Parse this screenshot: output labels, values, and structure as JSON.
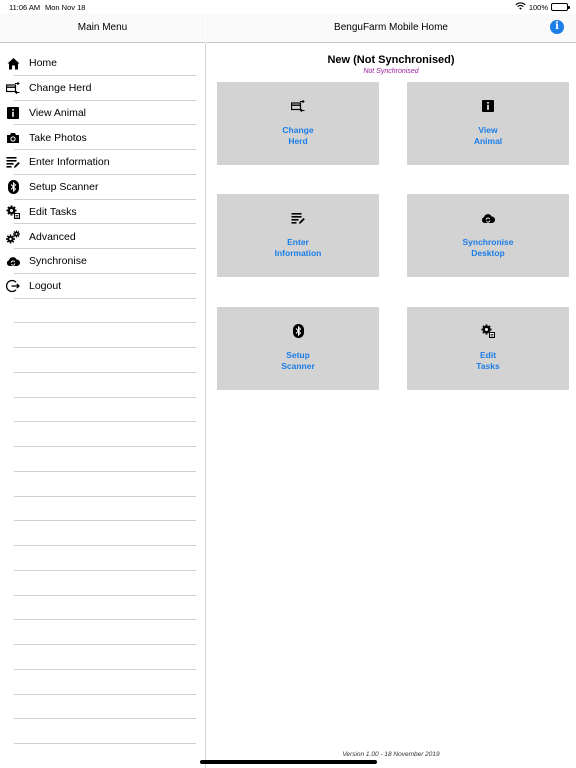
{
  "status_bar": {
    "time": "11:06 AM",
    "date": "Mon Nov 18",
    "battery": "100%",
    "icons": [
      "wifi-icon",
      "battery-icon"
    ]
  },
  "left_nav": {
    "title": "Main Menu"
  },
  "right_nav": {
    "title": "BenguFarm Mobile Home",
    "info_icon": "info-icon"
  },
  "sidebar": {
    "items": [
      {
        "label": "Home",
        "icon": "home-icon"
      },
      {
        "label": "Change Herd",
        "icon": "change-herd-icon"
      },
      {
        "label": "View Animal",
        "icon": "info-square-icon"
      },
      {
        "label": "Take Photos",
        "icon": "camera-icon"
      },
      {
        "label": "Enter Information",
        "icon": "edit-notes-icon"
      },
      {
        "label": "Setup Scanner",
        "icon": "bluetooth-icon"
      },
      {
        "label": "Edit Tasks",
        "icon": "gear-doc-icon"
      },
      {
        "label": "Advanced",
        "icon": "gears-icon"
      },
      {
        "label": "Synchronise",
        "icon": "cloud-sync-icon"
      },
      {
        "label": "Logout",
        "icon": "logout-icon"
      }
    ]
  },
  "main": {
    "title": "New (Not Synchronised)",
    "subtitle": "Not Synchronised",
    "tiles": [
      {
        "line1": "Change",
        "line2": "Herd",
        "icon": "change-herd-icon"
      },
      {
        "line1": "View",
        "line2": "Animal",
        "icon": "info-square-icon"
      },
      {
        "line1": "Enter",
        "line2": "Information",
        "icon": "edit-notes-icon"
      },
      {
        "line1": "Synchronise",
        "line2": "Desktop",
        "icon": "cloud-sync-icon"
      },
      {
        "line1": "Setup",
        "line2": "Scanner",
        "icon": "bluetooth-icon"
      },
      {
        "line1": "Edit",
        "line2": "Tasks",
        "icon": "gear-doc-icon"
      }
    ],
    "version": "Version 1.00 - 18 November 2019"
  },
  "colors": {
    "accent": "#1a7de8",
    "subtitle": "#9b1fa0",
    "tile_bg": "#d3d3d3"
  }
}
